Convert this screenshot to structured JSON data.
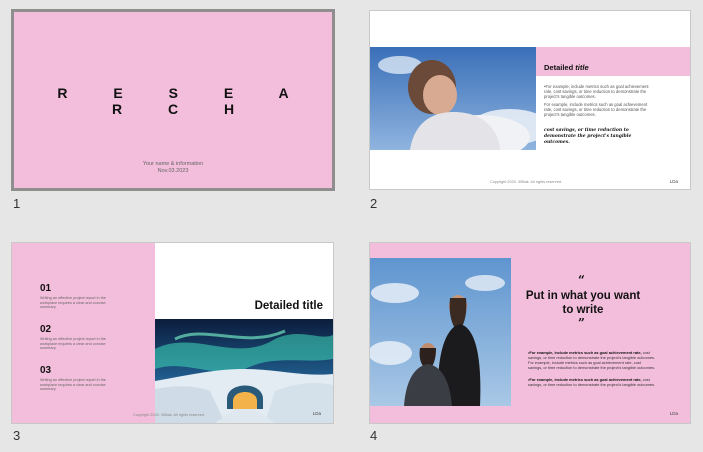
{
  "slides": [
    {
      "number": "1",
      "title": "R E S E A R C H",
      "presenter": "Your name & information",
      "date": "Nov.03.2023"
    },
    {
      "number": "2",
      "heading_main": "Detailed",
      "heading_italic": "title",
      "para1": "•For example, include metrics such as goal achievement rate, cost savings, or time reduction to demonstrate the project's tangible outcomes.",
      "para2": "For example, include metrics such as goal achievement rate, cost savings, or time reduction to demonstrate the project's tangible outcomes.",
      "handwriting": "cost savings, or time reduction to demonstrate the project's tangible outcomes.",
      "copyright": "Copyright 2025. 30Bak. All rights reserved.",
      "logo": "LDa"
    },
    {
      "number": "3",
      "items": [
        {
          "num": "01",
          "text": "Writing an effective project report in the workplace requires a clear and concise summary."
        },
        {
          "num": "02",
          "text": "Writing an effective project report in the workplace requires a clear and concise summary."
        },
        {
          "num": "03",
          "text": "Writing an effective project report in the workplace requires a clear and concise summary."
        }
      ],
      "heading": "Detailed title",
      "copyright": "Copyright 2025. 30Bak. All rights reserved.",
      "logo": "LDa"
    },
    {
      "number": "4",
      "quote_open": "“",
      "heading": "Put in what you want to write",
      "quote_close": "”",
      "para1_bold": "•For example, include metrics such as goal achievement rate,",
      "para1_rest": "cost savings, or time reduction to demonstrate the project's tangible outcomes. For example, include metrics such as goal achievement rate, cost savings, or time reduction to demonstrate the project's tangible outcomes.",
      "para2_bold": "•For example, include metrics such as goal achievement rate,",
      "para2_rest": "cost savings, or time reduction to demonstrate the project's tangible outcomes.",
      "logo": "LDa"
    }
  ],
  "colors": {
    "pink": "#f2bedb",
    "selection_border": "#8f8f8f",
    "background": "#e6e6e6"
  }
}
